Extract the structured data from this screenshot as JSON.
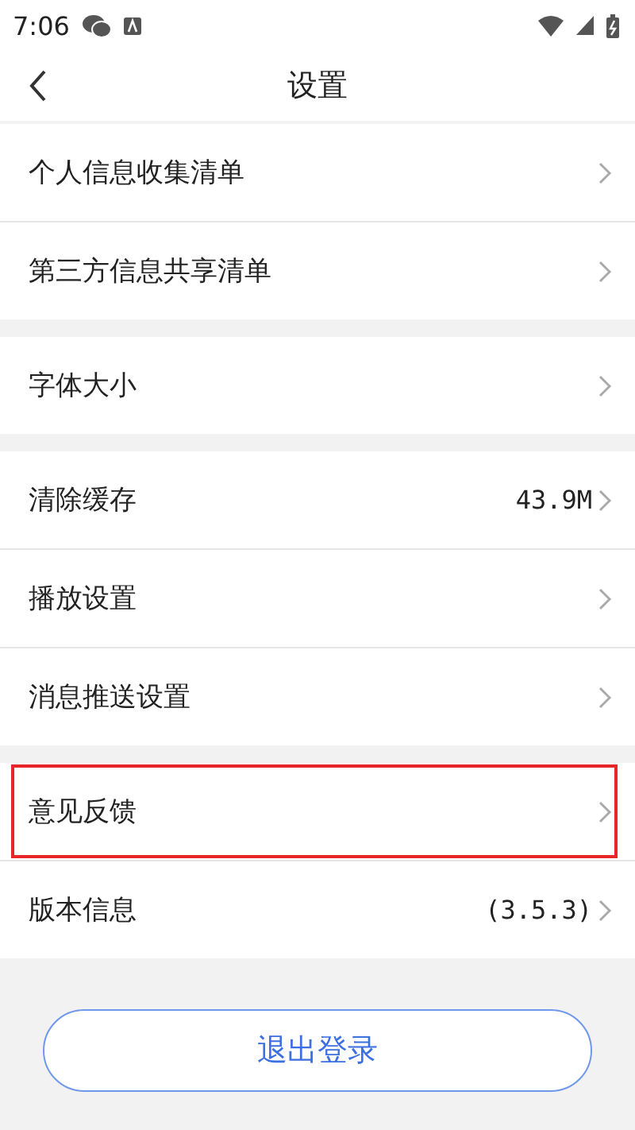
{
  "status_bar": {
    "time": "7:06"
  },
  "header": {
    "title": "设置"
  },
  "groups": [
    {
      "items": [
        {
          "label": "个人信息收集清单",
          "highlighted": false
        },
        {
          "label": "第三方信息共享清单",
          "highlighted": false
        }
      ]
    },
    {
      "items": [
        {
          "label": "字体大小",
          "highlighted": false
        }
      ]
    },
    {
      "items": [
        {
          "label": "清除缓存",
          "value": "43.9M",
          "highlighted": false
        },
        {
          "label": "播放设置",
          "highlighted": false
        },
        {
          "label": "消息推送设置",
          "highlighted": false
        }
      ]
    },
    {
      "items": [
        {
          "label": "意见反馈",
          "highlighted": true
        },
        {
          "label": "版本信息",
          "value": "(3.5.3)",
          "highlighted": false
        }
      ]
    }
  ],
  "logout_button": {
    "label": "退出登录"
  }
}
